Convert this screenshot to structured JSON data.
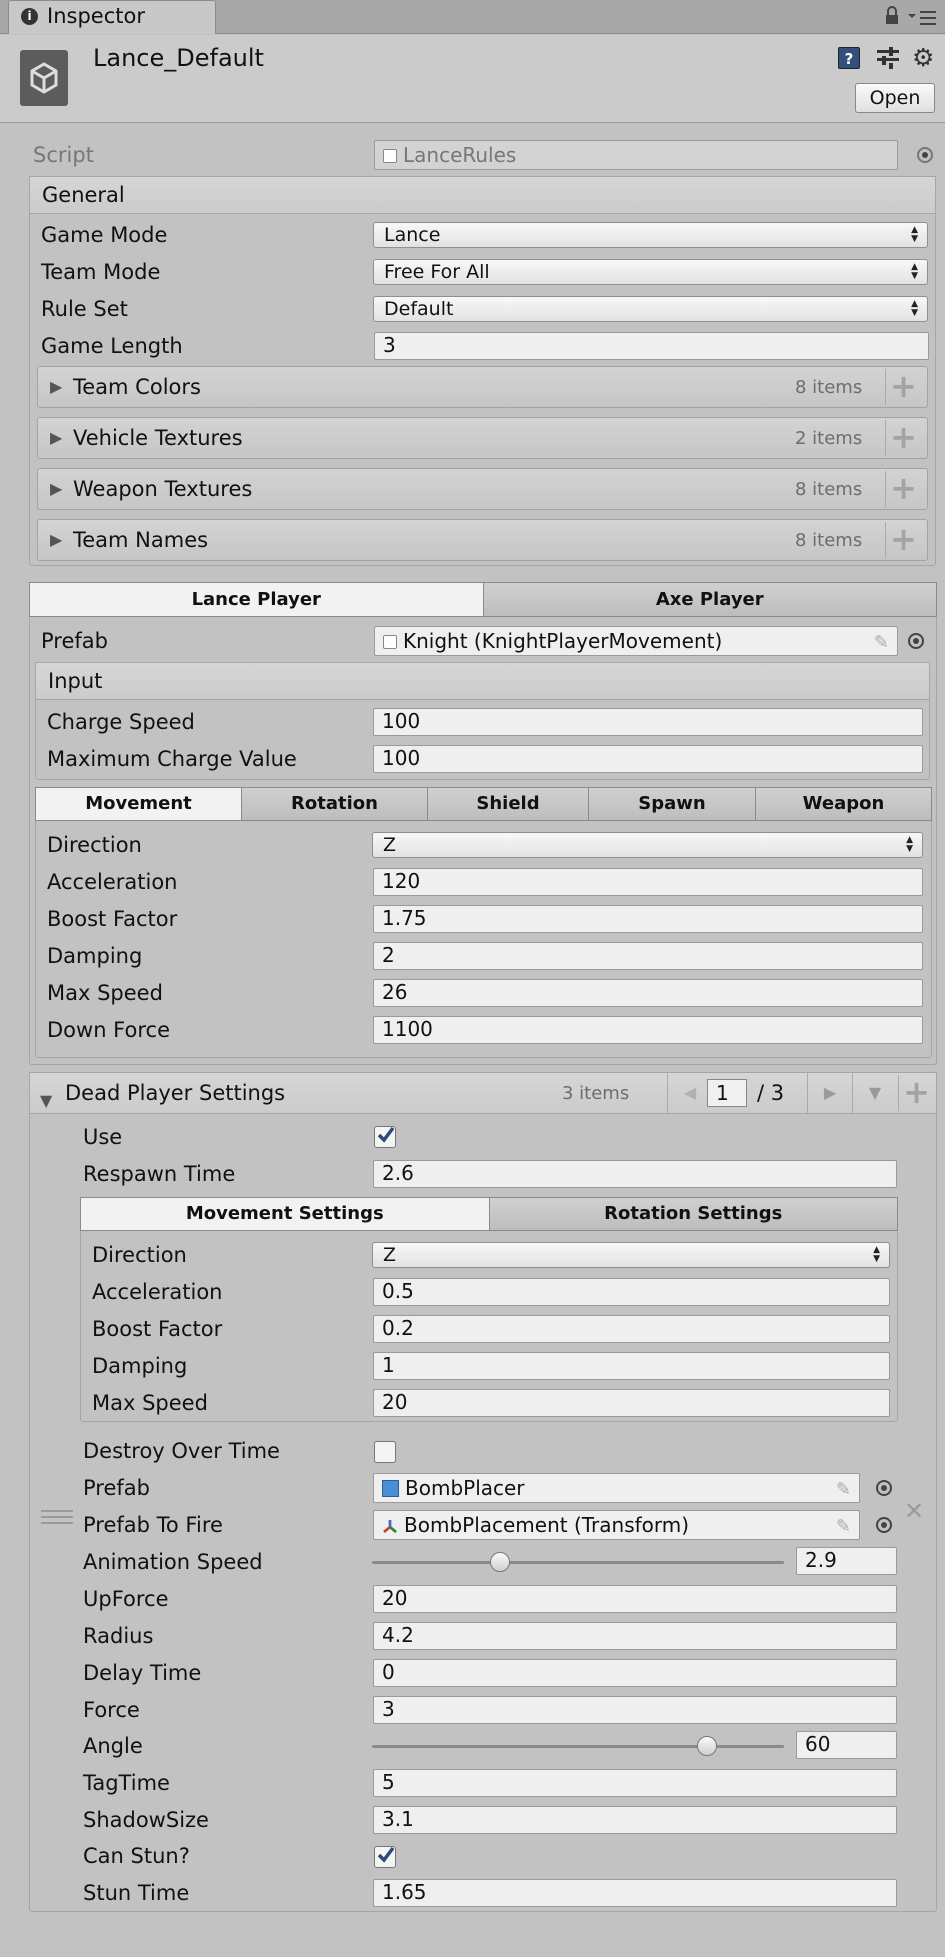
{
  "tab": {
    "title": "Inspector"
  },
  "header": {
    "asset_name": "Lance_Default",
    "open_label": "Open"
  },
  "script": {
    "label": "Script",
    "value": "LanceRules"
  },
  "general": {
    "title": "General",
    "fields": [
      {
        "label": "Game Mode",
        "value": "Lance"
      },
      {
        "label": "Team Mode",
        "value": "Free For All"
      },
      {
        "label": "Rule Set",
        "value": "Default"
      },
      {
        "label": "Game Length",
        "value": "3"
      }
    ],
    "lists": [
      {
        "label": "Team Colors",
        "count": "8 items"
      },
      {
        "label": "Vehicle Textures",
        "count": "2 items"
      },
      {
        "label": "Weapon Textures",
        "count": "8 items"
      },
      {
        "label": "Team Names",
        "count": "8 items"
      }
    ]
  },
  "player_tabs": [
    "Lance Player",
    "Axe Player"
  ],
  "prefab": {
    "label": "Prefab",
    "value": "Knight (KnightPlayerMovement)"
  },
  "input": {
    "title": "Input",
    "fields": [
      {
        "label": "Charge Speed",
        "value": "100"
      },
      {
        "label": "Maximum Charge Value",
        "value": "100"
      }
    ]
  },
  "sub_tabs": [
    "Movement",
    "Rotation",
    "Shield",
    "Spawn",
    "Weapon"
  ],
  "movement": {
    "direction": {
      "label": "Direction",
      "value": "Z"
    },
    "fields": [
      {
        "label": "Acceleration",
        "value": "120"
      },
      {
        "label": "Boost Factor",
        "value": "1.75"
      },
      {
        "label": "Damping",
        "value": "2"
      },
      {
        "label": "Max Speed",
        "value": "26"
      },
      {
        "label": "Down Force",
        "value": "1100"
      }
    ]
  },
  "dead": {
    "title": "Dead Player Settings",
    "count": "3 items",
    "page": "1",
    "page_total": "/ 3",
    "use_label": "Use",
    "use_checked": true,
    "respawn": {
      "label": "Respawn Time",
      "value": "2.6"
    },
    "settings_tabs": [
      "Movement Settings",
      "Rotation Settings"
    ],
    "move": {
      "direction": {
        "label": "Direction",
        "value": "Z"
      },
      "fields": [
        {
          "label": "Acceleration",
          "value": "0.5"
        },
        {
          "label": "Boost Factor",
          "value": "0.2"
        },
        {
          "label": "Damping",
          "value": "1"
        },
        {
          "label": "Max Speed",
          "value": "20"
        }
      ]
    },
    "destroy_label": "Destroy Over Time",
    "destroy_checked": false,
    "prefab": {
      "label": "Prefab",
      "value": "BombPlacer"
    },
    "prefab_fire": {
      "label": "Prefab To Fire",
      "value": "BombPlacement (Transform)"
    },
    "anim_speed": {
      "label": "Animation Speed",
      "value": "2.9",
      "fraction": 0.3
    },
    "fields_a": [
      {
        "label": "UpForce",
        "value": "20"
      },
      {
        "label": "Radius",
        "value": "4.2"
      },
      {
        "label": "Delay Time",
        "value": "0"
      },
      {
        "label": "Force",
        "value": "3"
      }
    ],
    "angle": {
      "label": "Angle",
      "value": "60",
      "fraction": 0.83
    },
    "fields_b": [
      {
        "label": "TagTime",
        "value": "5"
      },
      {
        "label": "ShadowSize",
        "value": "3.1"
      }
    ],
    "stun_label": "Can Stun?",
    "stun_checked": true,
    "stun_time": {
      "label": "Stun Time",
      "value": "1.65"
    }
  }
}
